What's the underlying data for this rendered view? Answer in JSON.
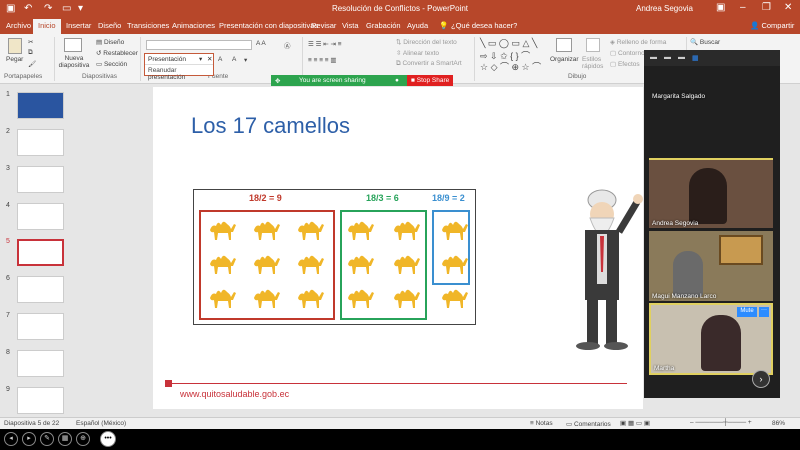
{
  "titlebar": {
    "title": "Resolución de Conflictos  -  PowerPoint",
    "user": "Andrea Segovia"
  },
  "tabs": [
    "Archivo",
    "Inicio",
    "Insertar",
    "Diseño",
    "Transiciones",
    "Animaciones",
    "Presentación con diapositivas",
    "Revisar",
    "Vista",
    "Grabación",
    "Ayuda",
    "¿Qué desea hacer?"
  ],
  "share_label": "Compartir",
  "ribbon": {
    "paste": "Pegar",
    "new_slide": "Nueva diapositiva",
    "layout": "Diseño",
    "reset": "Restablecer",
    "section": "Sección",
    "text_direction": "Dirección del texto",
    "align_text": "Alinear texto",
    "smartart": "Convertir a SmartArt",
    "arrange": "Organizar",
    "quick_styles": "Estilos rápidos",
    "fill": "Relleno de forma",
    "outline": "Contorno",
    "effects": "Efectos",
    "find": "Buscar",
    "groups": {
      "clipboard": "Portapapeles",
      "slides": "Diapositivas",
      "font": "Fuente",
      "drawing": "Dibujo"
    }
  },
  "dropdown": {
    "selected": "Presentación",
    "option": "Reanudar presentación"
  },
  "sharing": {
    "text": "You are screen sharing",
    "stop": "Stop Share"
  },
  "slide_numbers": [
    "1",
    "2",
    "3",
    "4",
    "5",
    "6",
    "7",
    "8",
    "9"
  ],
  "slide": {
    "title": "Los 17 camellos",
    "groups": [
      {
        "label": "18/2 = 9",
        "color": "#c0392b"
      },
      {
        "label": "18/3 = 6",
        "color": "#27a35a"
      },
      {
        "label": "18/9 = 2",
        "color": "#3a8fd0"
      }
    ],
    "url": "www.quitosaludable.gob.ec"
  },
  "zoom": {
    "participants": [
      "Margarita Salgado",
      "Andrea Segovia",
      "Magui Manzano Larco",
      "Martha"
    ],
    "mute": "Mute",
    "more": "···"
  },
  "status": {
    "slide_info": "Diapositiva 5 de 22",
    "language": "Español (México)",
    "notes": "Notas",
    "comments": "Comentarios",
    "zoom": "86%"
  }
}
